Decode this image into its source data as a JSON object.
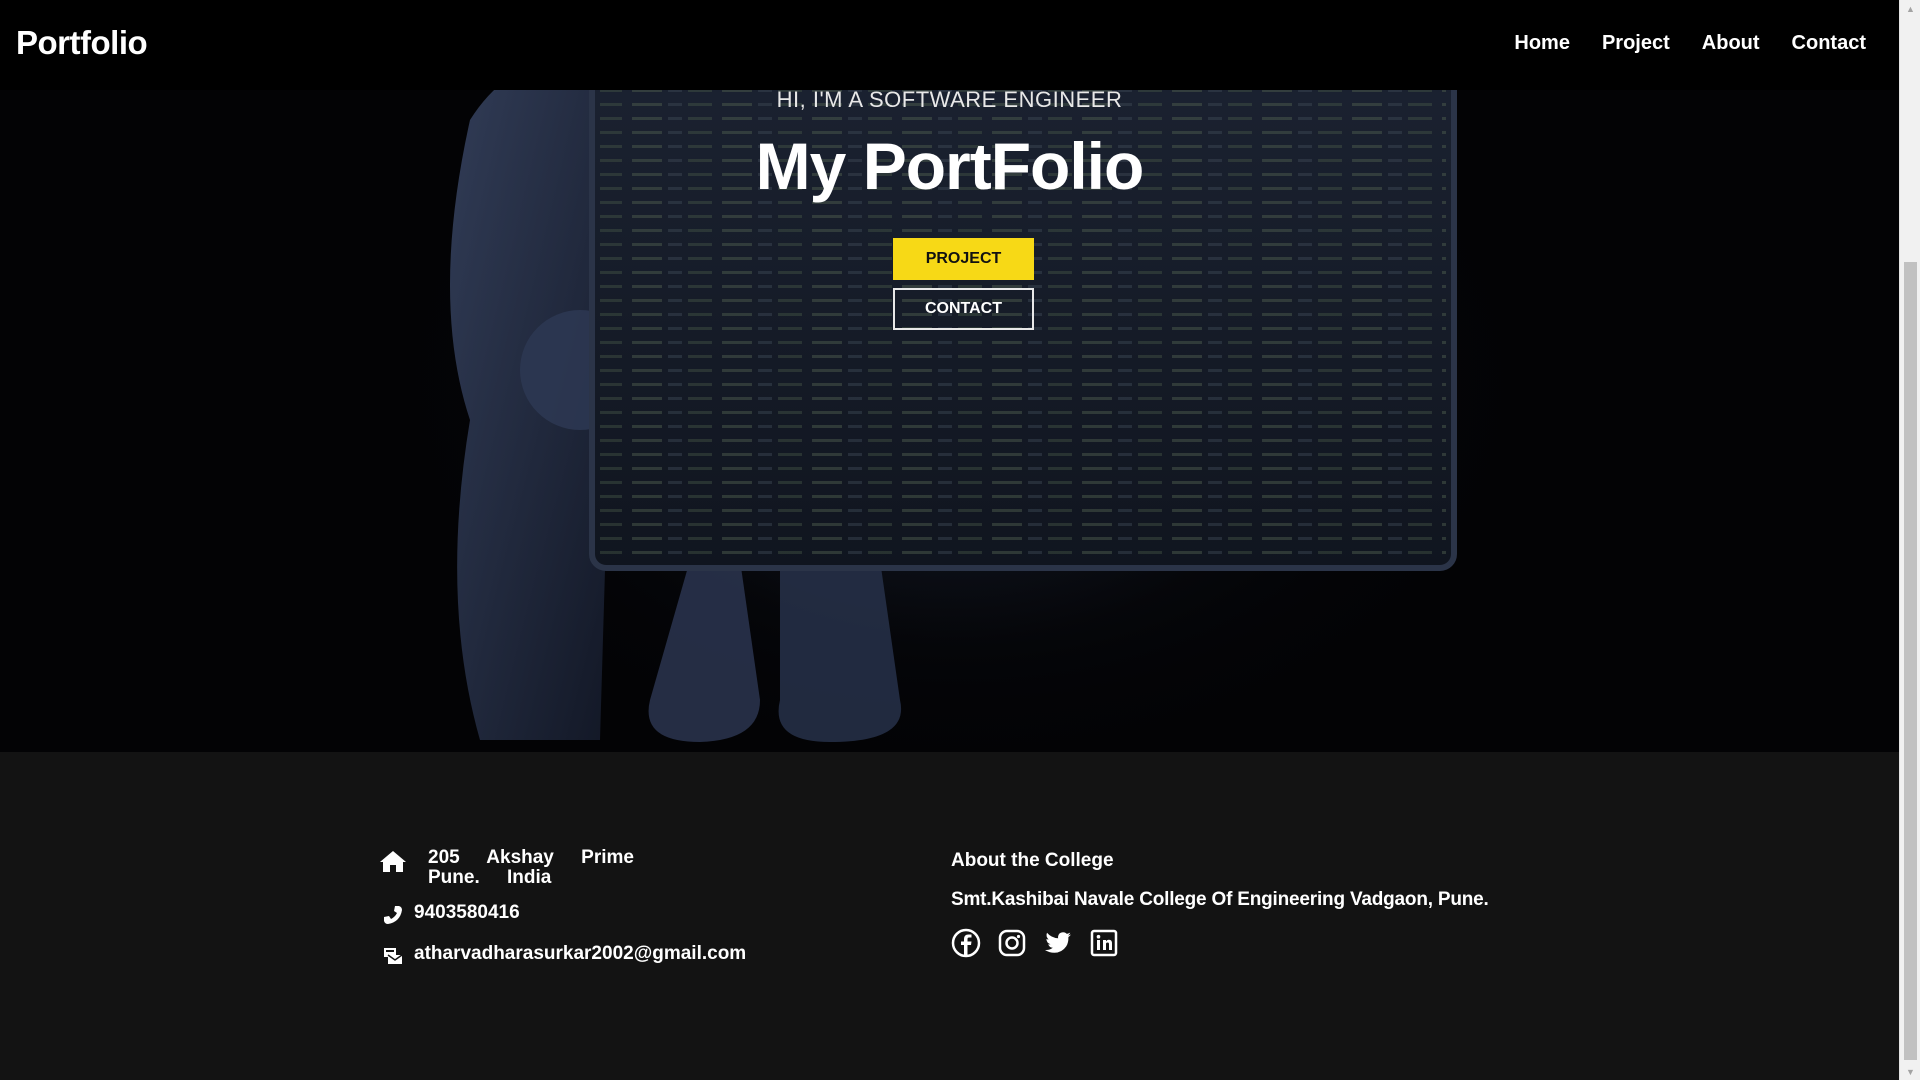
{
  "navbar": {
    "logo": "Portfolio",
    "links": [
      "Home",
      "Project",
      "About",
      "Contact"
    ]
  },
  "hero": {
    "subtitle": "HI, I'M A SOFTWARE ENGINEER",
    "title": "My PortFolio",
    "project_button": "PROJECT",
    "contact_button": "CONTACT"
  },
  "footer": {
    "address": "205 Akshay Prime Pune. India",
    "phone": "9403580416",
    "email": "atharvadharasurkar2002@gmail.com",
    "about_title": "About the College",
    "about_text": "Smt.Kashibai Navale College Of Engineering Vadgaon, Pune.",
    "socials": [
      "facebook-icon",
      "instagram-icon",
      "twitter-icon",
      "linkedin-icon"
    ]
  },
  "colors": {
    "accent": "#f7d916",
    "hero_bg": "#030305",
    "footer_bg": "#131313",
    "navbar_bg": "#000000"
  }
}
